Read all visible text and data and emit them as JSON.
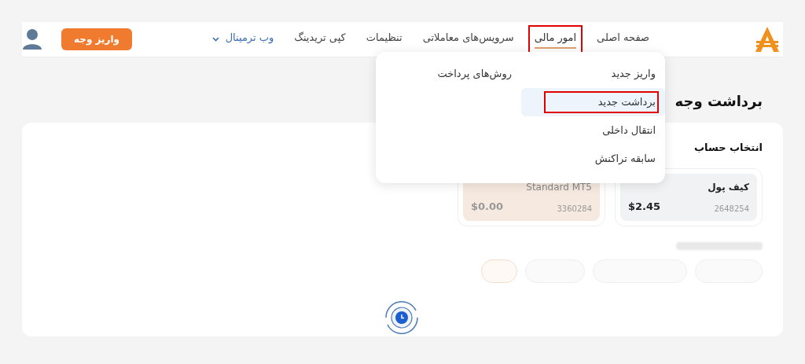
{
  "nav": {
    "items": [
      {
        "label": "صفحه اصلی",
        "selected": false,
        "highlighted": false,
        "kind": "link"
      },
      {
        "label": "امور مالی",
        "selected": true,
        "highlighted": true,
        "kind": "link"
      },
      {
        "label": "سرویس‌های معاملاتی",
        "selected": false,
        "highlighted": false,
        "kind": "link"
      },
      {
        "label": "تنظیمات",
        "selected": false,
        "highlighted": false,
        "kind": "link"
      },
      {
        "label": "کپی تریدینگ",
        "selected": false,
        "highlighted": false,
        "kind": "link"
      },
      {
        "label": "وب ترمینال",
        "selected": false,
        "highlighted": false,
        "kind": "dropdown"
      }
    ],
    "deposit_button": "واریز وجه"
  },
  "menu": {
    "columns": [
      [
        {
          "label": "واریز جدید",
          "selected": false,
          "highlighted": false
        },
        {
          "label": "برداشت جدید",
          "selected": true,
          "highlighted": true
        },
        {
          "label": "انتقال داخلی",
          "selected": false,
          "highlighted": false
        },
        {
          "label": "سابقه تراکنش",
          "selected": false,
          "highlighted": false
        }
      ],
      [
        {
          "label": "روش‌های پرداخت",
          "selected": false,
          "highlighted": false
        }
      ]
    ]
  },
  "page_title": "برداشت وجه",
  "account_section": {
    "title": "انتخاب حساب",
    "accounts": [
      {
        "name": "کیف پول",
        "number": "2648254",
        "balance": "$2.45",
        "color": "#f1f2f4"
      },
      {
        "name": "Standard MT5",
        "number": "3360284",
        "balance": "$0.00",
        "color": "#f6e9df"
      }
    ]
  }
}
